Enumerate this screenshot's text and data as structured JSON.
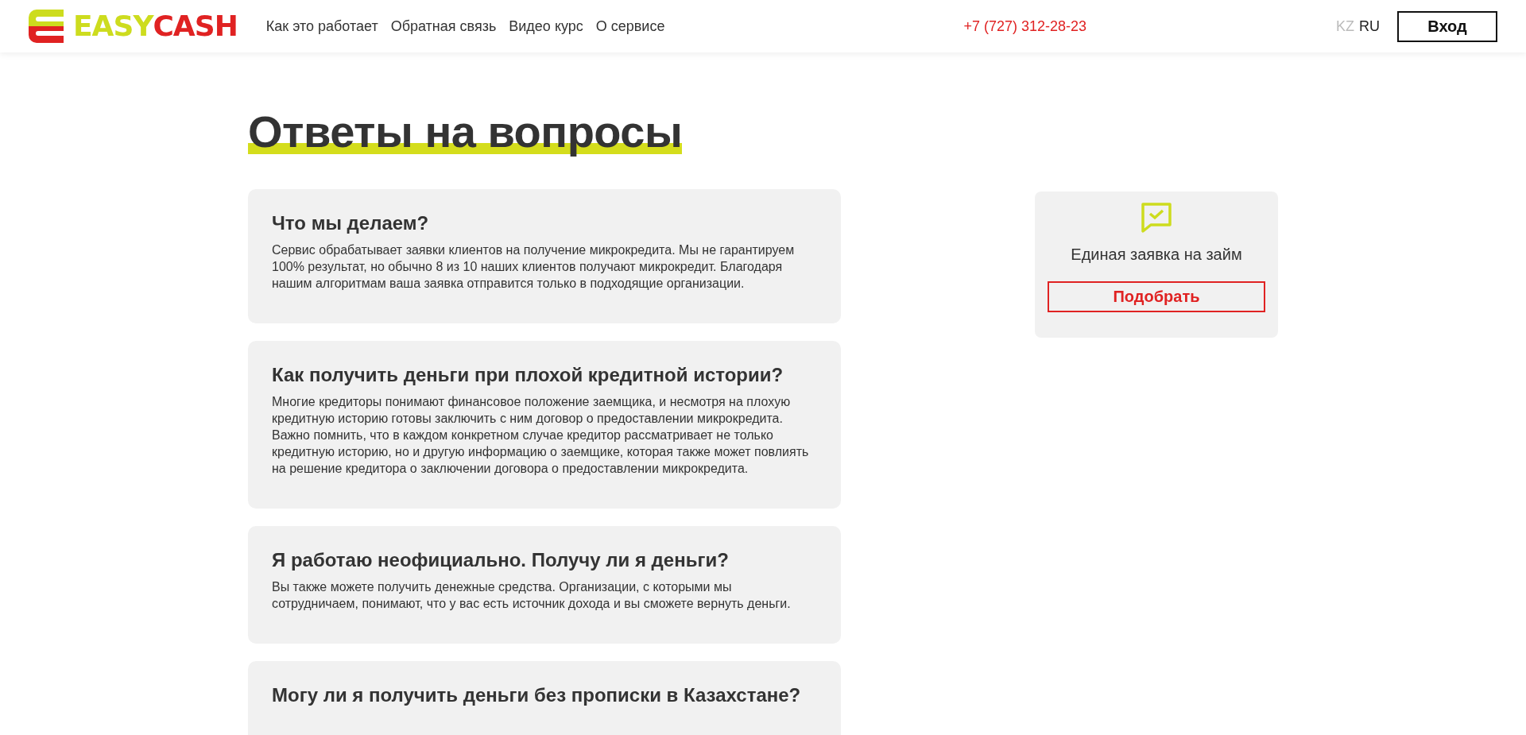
{
  "header": {
    "logo": {
      "part_1": "EASY",
      "part_2": "CASH"
    },
    "nav": [
      "Как это работает",
      "Обратная связь",
      "Видео курс",
      "О сервисе"
    ],
    "phone": "+7 (727) 312-28-23",
    "languages": [
      {
        "label": "KZ",
        "selected": false
      },
      {
        "label": "RU",
        "selected": true
      }
    ],
    "login_button": "Вход"
  },
  "page_title": "Ответы на вопросы",
  "faq": [
    {
      "question": "Что мы делаем?",
      "answer": "Сервис обрабатывает заявки клиентов на получение микрокредита. Мы не гарантируем 100% результат, но обычно 8 из 10 наших клиентов получают микрокредит. Благодаря нашим алгоритмам ваша заявка отправится только в подходящие организации."
    },
    {
      "question": "Как получить деньги при плохой кредитной истории?",
      "answer": "Многие кредиторы понимают финансовое положение заемщика, и несмотря на плохую кредитную историю готовы заключить с ним договор о предоставлении микрокредита. Важно помнить, что в каждом конкретном случае кредитор рассматривает не только кредитную историю, но и другую информацию о заемщике, которая также может повлиять на решение кредитора о заключении договора о предоставлении микрокредита."
    },
    {
      "question": "Я работаю неофициально. Получу ли я деньги?",
      "answer": "Вы также можете получить денежные средства. Организации, с которыми мы сотрудничаем, понимают, что у вас есть источник дохода и вы сможете вернуть деньги."
    },
    {
      "question": "Могу ли я получить деньги без прописки в Казахстане?"
    }
  ],
  "side_card": {
    "title": "Единая заявка на займ",
    "button": "Подобрать"
  }
}
